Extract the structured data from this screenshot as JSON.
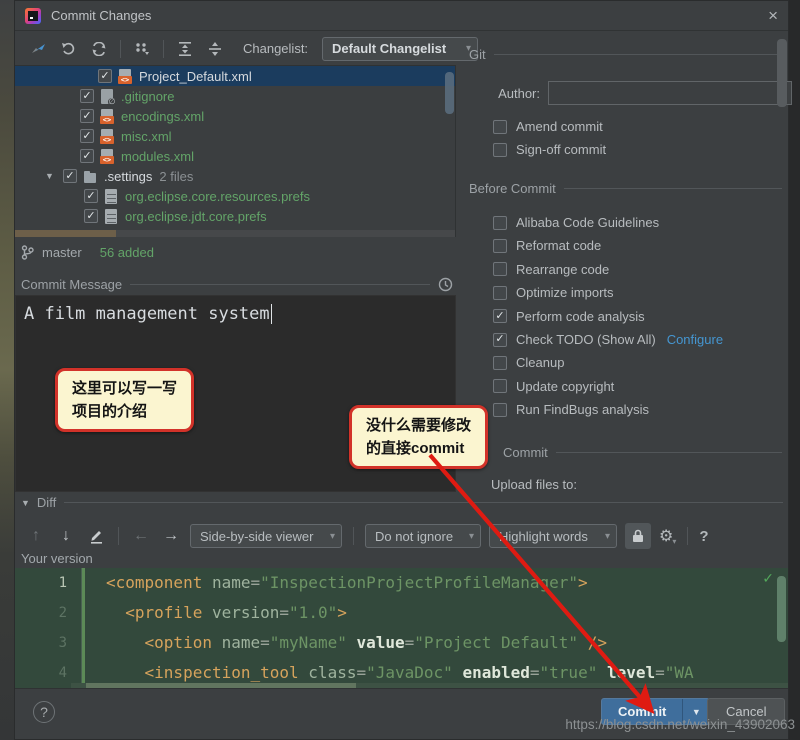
{
  "window": {
    "title": "Commit Changes",
    "close_glyph": "×"
  },
  "toolbar": {
    "changelist_label": "Changelist:",
    "changelist_value": "Default Changelist",
    "icons": [
      "show-diff-icon",
      "rollback-icon",
      "refresh-icon",
      "group-by-icon",
      "expand-all-icon",
      "collapse-all-icon"
    ]
  },
  "tree": {
    "items": [
      {
        "label": "Project_Default.xml",
        "type": "xml",
        "depth": 4,
        "checked": true,
        "selected": true
      },
      {
        "label": ".gitignore",
        "type": "gitignore",
        "depth": 2,
        "checked": true
      },
      {
        "label": "encodings.xml",
        "type": "xml",
        "depth": 2,
        "checked": true
      },
      {
        "label": "misc.xml",
        "type": "xml",
        "depth": 2,
        "checked": true
      },
      {
        "label": "modules.xml",
        "type": "xml",
        "depth": 2,
        "checked": true
      },
      {
        "label": ".settings",
        "suffix": "2 files",
        "type": "folder",
        "depth": 1,
        "checked": true,
        "expanded": true
      },
      {
        "label": "org.eclipse.core.resources.prefs",
        "type": "prefs",
        "depth": 3,
        "checked": true
      },
      {
        "label": "org.eclipse.jdt.core.prefs",
        "type": "prefs",
        "depth": 3,
        "checked": true
      }
    ],
    "branch": "master",
    "added": "56 added"
  },
  "commit_message": {
    "label": "Commit Message",
    "text": "A film management system"
  },
  "git_panel": {
    "section": "Git",
    "author_label": "Author:",
    "author_value": "",
    "options": [
      {
        "label": "Amend commit",
        "checked": false
      },
      {
        "label": "Sign-off commit",
        "checked": false
      }
    ]
  },
  "before_commit": {
    "section": "Before Commit",
    "options": [
      {
        "label": "Alibaba Code Guidelines",
        "checked": false
      },
      {
        "label": "Reformat code",
        "checked": false
      },
      {
        "label": "Rearrange code",
        "checked": false
      },
      {
        "label": "Optimize imports",
        "checked": false
      },
      {
        "label": "Perform code analysis",
        "checked": true
      },
      {
        "label": "Check TODO (Show All)",
        "checked": true,
        "link": "Configure"
      },
      {
        "label": "Cleanup",
        "checked": false
      },
      {
        "label": "Update copyright",
        "checked": false
      },
      {
        "label": "Run FindBugs analysis",
        "checked": false
      }
    ]
  },
  "after_commit": {
    "section": "Commit",
    "upload_label": "Upload files to:"
  },
  "diff": {
    "section": "Diff",
    "viewer_dropdown": "Side-by-side viewer",
    "ignore_dropdown": "Do not ignore",
    "highlight_dropdown": "Highlight words",
    "your_version_label": "Your version"
  },
  "code": {
    "lines": [
      {
        "num": "1",
        "indent": 0,
        "tokens": [
          [
            "tag",
            "<component"
          ],
          [
            "pun",
            " "
          ],
          [
            "attr",
            "name"
          ],
          [
            "pun",
            "="
          ],
          [
            "str",
            "\"InspectionProjectProfileManager\""
          ],
          [
            "tag",
            ">"
          ]
        ]
      },
      {
        "num": "2",
        "indent": 1,
        "tokens": [
          [
            "tag",
            "<profile"
          ],
          [
            "pun",
            " "
          ],
          [
            "attr",
            "version"
          ],
          [
            "pun",
            "="
          ],
          [
            "str",
            "\"1.0\""
          ],
          [
            "tag",
            ">"
          ]
        ]
      },
      {
        "num": "3",
        "indent": 2,
        "tokens": [
          [
            "tag",
            "<option"
          ],
          [
            "pun",
            " "
          ],
          [
            "attr",
            "name"
          ],
          [
            "pun",
            "="
          ],
          [
            "str",
            "\"myName\""
          ],
          [
            "pun",
            " "
          ],
          [
            "attrb",
            "value"
          ],
          [
            "pun",
            "="
          ],
          [
            "str",
            "\"Project Default\""
          ],
          [
            "pun",
            " "
          ],
          [
            "tag",
            "/>"
          ]
        ]
      },
      {
        "num": "4",
        "indent": 2,
        "tokens": [
          [
            "tag",
            "<inspection_tool"
          ],
          [
            "pun",
            " "
          ],
          [
            "attr",
            "class"
          ],
          [
            "pun",
            "="
          ],
          [
            "str",
            "\"JavaDoc\""
          ],
          [
            "pun",
            " "
          ],
          [
            "attrb",
            "enabled"
          ],
          [
            "pun",
            "="
          ],
          [
            "str",
            "\"true\""
          ],
          [
            "pun",
            " "
          ],
          [
            "attrb",
            "level"
          ],
          [
            "pun",
            "="
          ],
          [
            "str",
            "\"WA"
          ]
        ]
      }
    ]
  },
  "annotations": {
    "callout1": {
      "line1": "这里可以写一写",
      "line2": "项目的介绍"
    },
    "callout2": {
      "line1": "没什么需要修改",
      "line2": "的直接commit"
    },
    "arrow_color": "#df1b12"
  },
  "footer": {
    "commit_label": "Commit",
    "cancel_label": "Cancel",
    "help_glyph": "?"
  },
  "watermark": "https://blog.csdn.net/weixin_43902063",
  "glyphs": {
    "dropdown_arrow": "▾",
    "expander": "▼",
    "check": "✓",
    "up_arrow": "↑",
    "down_arrow": "↓",
    "left_arrow": "←",
    "right_arrow": "→",
    "gear": "⚙",
    "slash_circle": "∅"
  },
  "colors": {
    "selection": "#1b3c5e",
    "added_file_green": "#63a468",
    "link_blue": "#4596d1",
    "commit_button_blue": "#3f6e9c",
    "callout_bg": "#fbf5d0",
    "callout_border": "#d23229",
    "code_bg": "#33493c"
  }
}
